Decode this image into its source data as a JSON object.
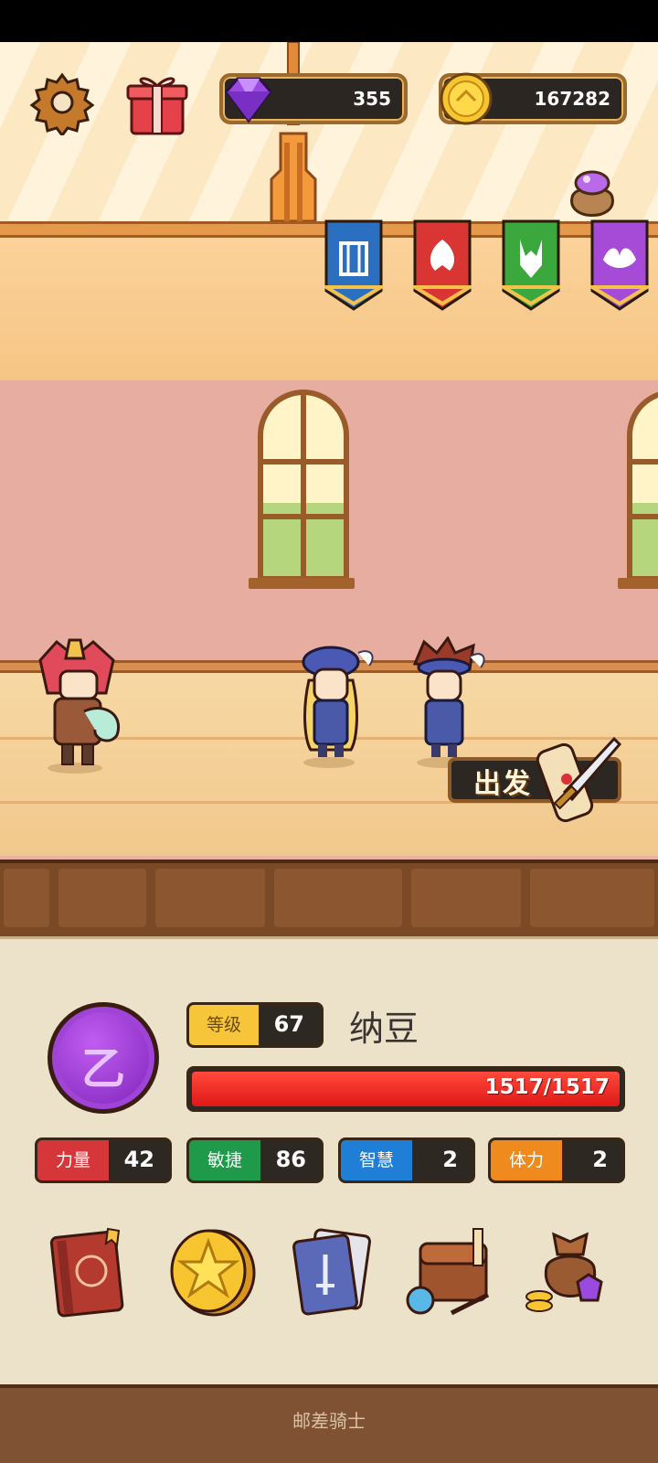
{
  "hud": {
    "gems": "355",
    "coins": "167282"
  },
  "colors": {
    "banner_blue": "#2a6fc0",
    "banner_red": "#d93532",
    "banner_green": "#3aa83c",
    "banner_purple": "#a64ad8",
    "hp_red": "#e01818",
    "rank_purple": "#8f2fd0"
  },
  "banners": [
    "blue-crest",
    "red-crest",
    "green-crest",
    "purple-crest"
  ],
  "scene": {
    "depart_label": "出发"
  },
  "hero": {
    "rank_letter": "乙",
    "level_label": "等级",
    "level": "67",
    "name": "纳豆",
    "hp_text": "1517/1517",
    "hp_fraction": 1.0,
    "stats": [
      {
        "label": "力量",
        "value": "42",
        "color": "#d4363a"
      },
      {
        "label": "敏捷",
        "value": "86",
        "color": "#1f9a4a"
      },
      {
        "label": "智慧",
        "value": "2",
        "color": "#1f7ed6"
      },
      {
        "label": "体力",
        "value": "2",
        "color": "#ef8a1e"
      }
    ]
  },
  "menu": [
    {
      "icon": "hero-book-icon"
    },
    {
      "icon": "star-coin-icon"
    },
    {
      "icon": "sword-cards-icon"
    },
    {
      "icon": "item-backpack-icon"
    },
    {
      "icon": "treasure-bag-icon"
    }
  ],
  "footer": {
    "title": "邮差骑士"
  }
}
